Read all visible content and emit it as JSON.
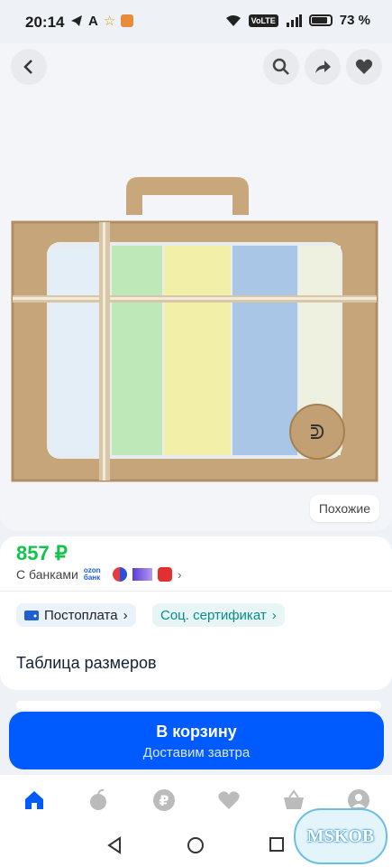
{
  "status": {
    "time": "20:14",
    "battery": "73 %",
    "volte": "VoLTE"
  },
  "colors": {
    "accent": "#005bff",
    "price": "#10c44c"
  },
  "icons": [
    "back-arrow-icon",
    "search-icon",
    "share-icon",
    "heart-icon"
  ],
  "image": {
    "similar_label": "Похожие"
  },
  "product": {
    "price": "857 ₽",
    "banks_label": "С банками",
    "ozon_bank": "ozon банк",
    "chip_postpay": "Постоплата",
    "chip_social": "Соц. сертификат",
    "size_table": "Таблица размеров"
  },
  "cart": {
    "label": "В корзину",
    "sub": "Доставим завтра"
  },
  "tabs": [
    "home-icon",
    "apple-icon",
    "ruble-icon",
    "favorites-icon",
    "basket-icon",
    "profile-icon"
  ],
  "watermark": "MSKOB"
}
